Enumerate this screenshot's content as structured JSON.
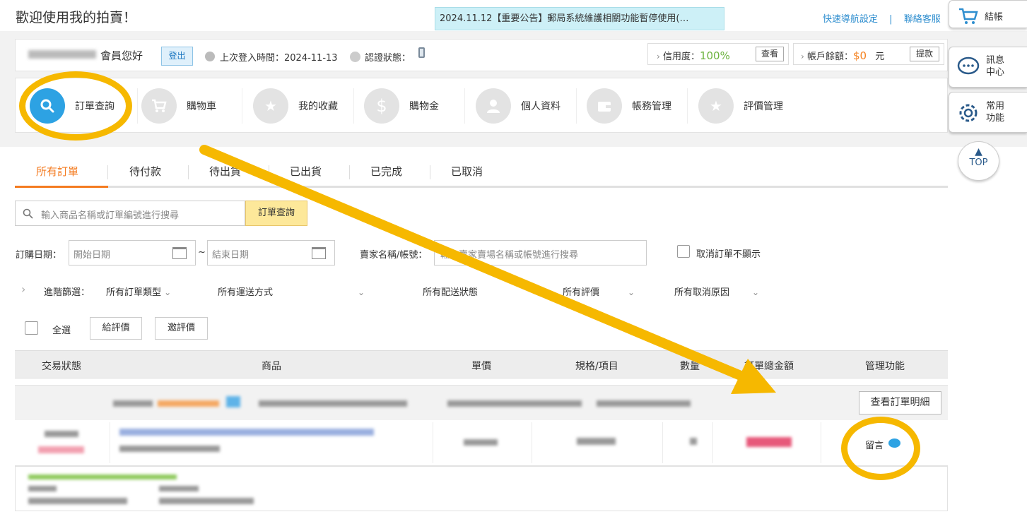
{
  "header": {
    "welcome": "歡迎使用我的拍賣！",
    "notice": "2024.11.12【重要公告】郵局系統維護相關功能暫停使用(…",
    "quick_nav": "快速導航設定",
    "separator": "|",
    "contact": "聯絡客服"
  },
  "member": {
    "greeting": "會員您好",
    "logout": "登出",
    "last_login": "上次登入時間：2024-11-13",
    "cert_label": "認證狀態："
  },
  "credit": {
    "label": "信用度：",
    "value": "100%",
    "button": "查看"
  },
  "balance": {
    "label": "帳戶餘額：",
    "value": "$0",
    "unit": "元",
    "button": "提款"
  },
  "nav": {
    "items": [
      {
        "label": "訂單查詢",
        "icon": "search-icon"
      },
      {
        "label": "購物車",
        "icon": "cart-icon"
      },
      {
        "label": "我的收藏",
        "icon": "star-icon"
      },
      {
        "label": "購物金",
        "icon": "dollar-icon"
      },
      {
        "label": "個人資料",
        "icon": "person-icon"
      },
      {
        "label": "帳務管理",
        "icon": "wallet-icon"
      },
      {
        "label": "評價管理",
        "icon": "star-icon"
      }
    ]
  },
  "sidebar": {
    "checkout": "結帳",
    "message_1": "訊息",
    "message_2": "中心",
    "common_1": "常用",
    "common_2": "功能",
    "top": "TOP"
  },
  "tabs": [
    "所有訂單",
    "待付款",
    "待出貨",
    "已出貨",
    "已完成",
    "已取消"
  ],
  "search": {
    "placeholder": "輸入商品名稱或訂單編號進行搜尋",
    "button": "訂單查詢"
  },
  "filters": {
    "date_label": "訂購日期：",
    "start_placeholder": "開始日期",
    "range_sep": "~",
    "end_placeholder": "結束日期",
    "seller_label": "賣家名稱/帳號：",
    "seller_placeholder": "輸入賣家賣場名稱或帳號進行搜尋",
    "hide_cancelled": "取消訂單不顯示",
    "advanced_label": "進階篩選：",
    "order_type": "所有訂單類型",
    "transport": "所有運送方式",
    "delivery": "所有配送狀態",
    "rating": "所有評價",
    "cancel_reason": "所有取消原因"
  },
  "actions": {
    "select_all": "全選",
    "give_rating": "給評價",
    "invite_rating": "邀評價"
  },
  "table": {
    "headers": [
      "交易狀態",
      "商品",
      "單價",
      "規格/項目",
      "數量",
      "訂單總金額",
      "管理功能"
    ],
    "detail_button": "查看訂單明細",
    "message": "留言"
  },
  "colors": {
    "accent_orange": "#f47b20",
    "highlight_yellow": "#f6b800",
    "link_blue": "#2e8ecf"
  }
}
